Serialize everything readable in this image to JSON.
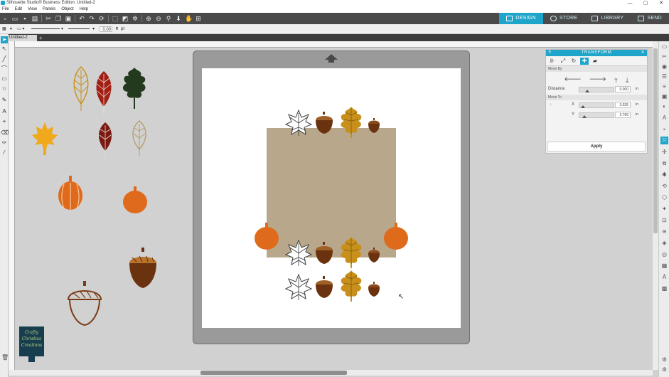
{
  "app": {
    "title": "Silhouette Studio® Business Edition: Untitled-2",
    "window_controls": [
      "—",
      "▢",
      "✕"
    ]
  },
  "menu": [
    "File",
    "Edit",
    "View",
    "Panels",
    "Object",
    "Help"
  ],
  "tabs": [
    {
      "label": "DESIGN",
      "active": true
    },
    {
      "label": "STORE",
      "active": false
    },
    {
      "label": "LIBRARY",
      "active": false
    },
    {
      "label": "SEND",
      "active": false
    }
  ],
  "line_settings": {
    "width_value": "0.00",
    "unit": "pt"
  },
  "document": {
    "tab_label": "Untitled-2",
    "add_tab": "+"
  },
  "logo": {
    "line1": "Crafty",
    "line2": "Christies",
    "line3": "Creations"
  },
  "transform_panel": {
    "title": "TRANSFORM",
    "section_move_by": "Move By",
    "distance_label": "Distance",
    "distance_value": "0.000",
    "distance_unit": "in",
    "section_move_to": "Move To",
    "x_label": "X",
    "x_value": "3.035",
    "x_unit": "in",
    "y_label": "Y",
    "y_value": "2.766",
    "y_unit": "in",
    "apply_label": "Apply"
  },
  "colors": {
    "accent": "#1ea5c9",
    "toolbar": "#4a4a4a",
    "tan_square": "#b8a78b",
    "pumpkin": "#e06a1b",
    "acorn": "#6b3210",
    "gold_leaf": "#c8901a",
    "red_leaf": "#a02016",
    "green_leaf": "#243a1e"
  }
}
